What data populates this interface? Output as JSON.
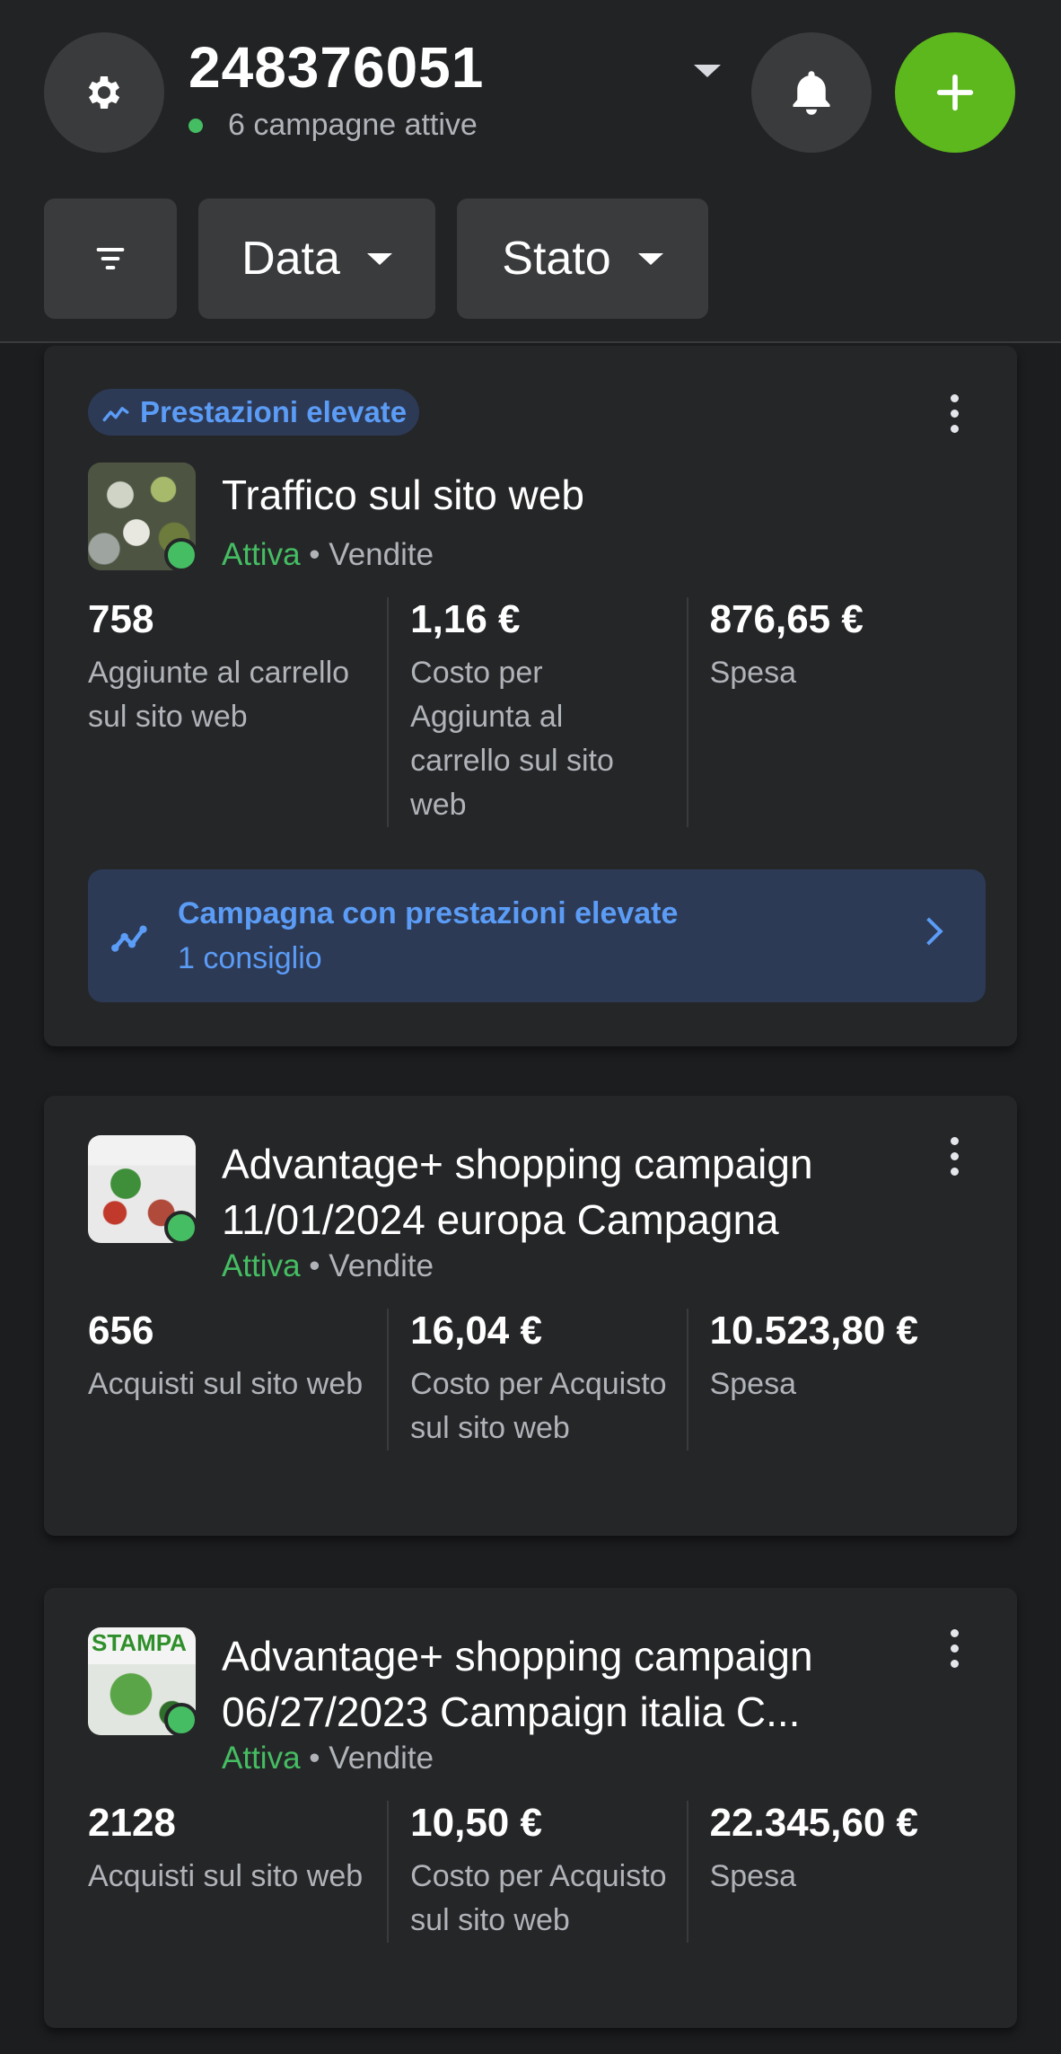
{
  "header": {
    "account_id": "248376051",
    "campaign_status": "6 campagne attive",
    "filters": {
      "date_label": "Data",
      "state_label": "Stato"
    }
  },
  "campaigns": [
    {
      "badge": "Prestazioni elevate",
      "title": "Traffico sul sito web",
      "status": "Attiva",
      "separator": "•",
      "objective": "Vendite",
      "metrics": [
        {
          "value": "758",
          "label": "Aggiunte al carrello sul sito web"
        },
        {
          "value": "1,16 €",
          "label": "Costo per Aggiunta al carrello sul sito web"
        },
        {
          "value": "876,65 €",
          "label": "Spesa"
        }
      ],
      "recommendation": {
        "title": "Campagna con prestazioni elevate",
        "subtitle": "1 consiglio"
      }
    },
    {
      "title": "Advantage+ shopping campaign 11/01/2024 europa Campagna",
      "status": "Attiva",
      "separator": "•",
      "objective": "Vendite",
      "metrics": [
        {
          "value": "656",
          "label": "Acquisti sul sito web"
        },
        {
          "value": "16,04 €",
          "label": "Costo per Acquisto sul sito web"
        },
        {
          "value": "10.523,80 €",
          "label": "Spesa"
        }
      ]
    },
    {
      "title": "Advantage+ shopping campaign 06/27/2023 Campaign italia C...",
      "status": "Attiva",
      "separator": "•",
      "objective": "Vendite",
      "thumb_text": "STAMPA",
      "metrics": [
        {
          "value": "2128",
          "label": "Acquisti sul sito web"
        },
        {
          "value": "10,50 €",
          "label": "Costo per Acquisto sul sito web"
        },
        {
          "value": "22.345,60 €",
          "label": "Spesa"
        }
      ]
    }
  ],
  "colors": {
    "accent_green": "#5cb81c",
    "status_green": "#45bd62",
    "accent_blue": "#5b9cf6"
  },
  "icons": [
    "gear-icon",
    "chevron-down-icon",
    "bell-icon",
    "plus-icon",
    "filter-icon",
    "trend-icon",
    "more-icon",
    "chevron-right-icon"
  ]
}
